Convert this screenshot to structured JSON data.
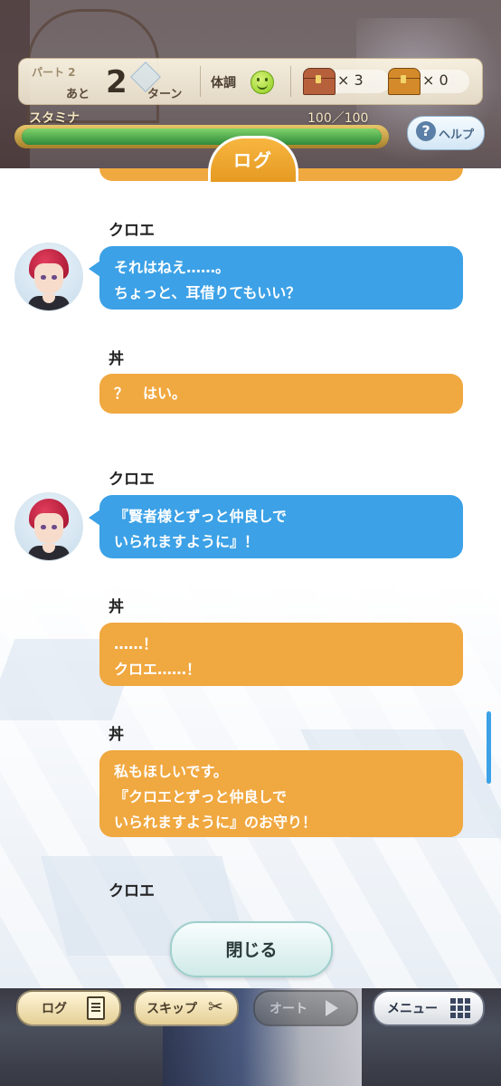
{
  "hud": {
    "part_label": "パート 2",
    "remaining_prefix": "あと",
    "turns_left": "2",
    "turn_suffix": "ターン",
    "condition_label": "体調",
    "condition_icon": "smile-face-icon",
    "chest_red_count": "× 3",
    "chest_gold_count": "× 0",
    "stamina_label": "スタミナ",
    "stamina_value": "100／100",
    "stamina_fraction": 1.0,
    "help_label": "ヘルプ"
  },
  "log": {
    "tab_title": "ログ",
    "entries": [
      {
        "speaker": "クロエ",
        "lines": [
          "それはねえ……。",
          "ちょっと、耳借りてもいい？"
        ],
        "style": "character"
      },
      {
        "speaker": "丼",
        "lines": [
          "？　はい。"
        ],
        "style": "player"
      },
      {
        "speaker": "クロエ",
        "lines": [
          "『賢者様とずっと仲良しで",
          "いられますように』！"
        ],
        "style": "character"
      },
      {
        "speaker": "丼",
        "lines": [
          "……！",
          "クロエ……！"
        ],
        "style": "player"
      },
      {
        "speaker": "丼",
        "lines": [
          "私もほしいです。",
          "『クロエとずっと仲良しで",
          "いられますように』のお守り！"
        ],
        "style": "player"
      },
      {
        "speaker": "クロエ",
        "lines": [],
        "style": "character"
      }
    ],
    "close_label": "閉じる"
  },
  "toolbar": {
    "log_label": "ログ",
    "skip_label": "スキップ",
    "auto_label": "オート",
    "menu_label": "メニュー"
  },
  "colors": {
    "character_bubble": "#3ca1e6",
    "player_bubble": "#f0a840",
    "tab": "#f0a840"
  }
}
